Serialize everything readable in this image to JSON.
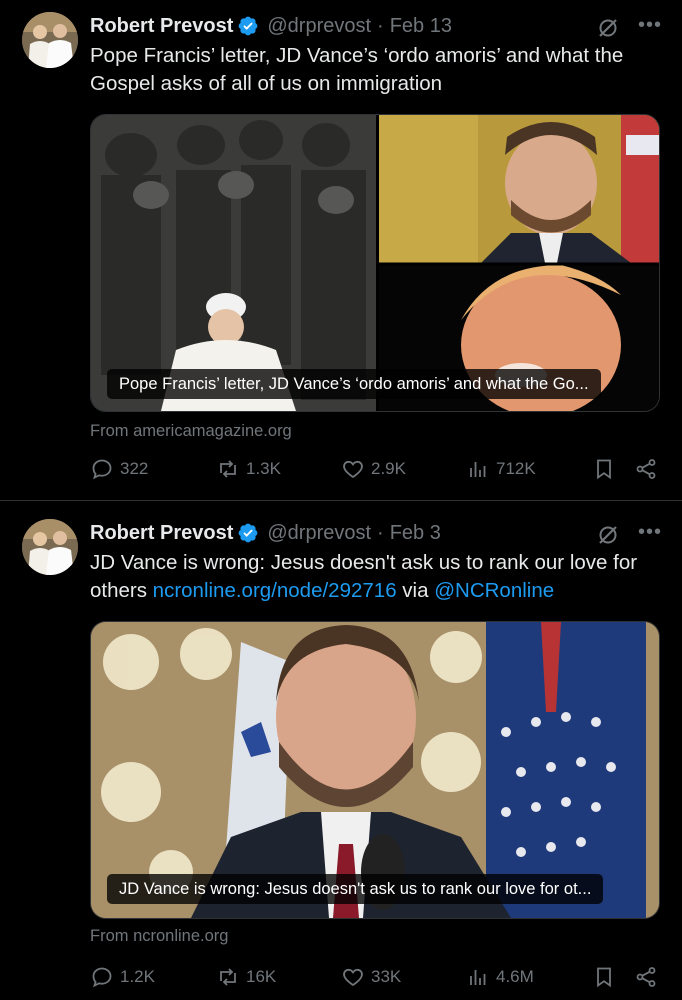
{
  "posts": [
    {
      "author_name": "Robert Prevost",
      "author_handle": "@drprevost",
      "separator": "·",
      "date": "Feb 13",
      "text": "Pope Francis’ letter, JD Vance’s ‘ordo amoris’ and what the Gospel asks of all of us on immigration",
      "media_caption": "Pope Francis’ letter, JD Vance’s ‘ordo amoris’ and what the Go...",
      "source": "From americamagazine.org",
      "replies": "322",
      "reposts": "1.3K",
      "likes": "2.9K",
      "views": "712K"
    },
    {
      "author_name": "Robert Prevost",
      "author_handle": "@drprevost",
      "separator": "·",
      "date": "Feb 3",
      "text_prefix": "JD Vance is wrong: Jesus doesn't ask us to rank our love for others ",
      "text_link": "ncronline.org/node/292716",
      "text_via": " via ",
      "text_mention": "@NCRonline",
      "media_caption": "JD Vance is wrong: Jesus doesn't ask us to rank our love for ot...",
      "source": "From ncronline.org",
      "replies": "1.2K",
      "reposts": "16K",
      "likes": "33K",
      "views": "4.6M"
    }
  ],
  "icons": [
    "verified-badge-icon",
    "grok-icon",
    "more-icon",
    "reply-icon",
    "repost-icon",
    "like-icon",
    "views-icon",
    "bookmark-icon",
    "share-icon"
  ],
  "colors": {
    "background": "#000000",
    "text": "#e7e9ea",
    "muted": "#71767b",
    "link": "#1d9bf0",
    "verified": "#1d9bf0"
  }
}
